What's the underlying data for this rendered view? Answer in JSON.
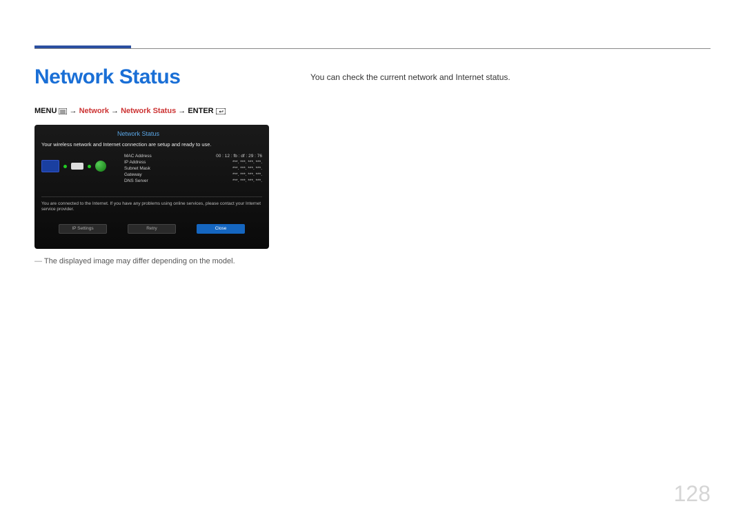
{
  "page": {
    "title": "Network Status",
    "page_number": "128"
  },
  "breadcrumb": {
    "menu_label": "MENU",
    "arrow": "→",
    "item1": "Network",
    "item2": "Network Status",
    "enter_label": "ENTER"
  },
  "screenshot": {
    "title": "Network Status",
    "message": "Your wireless network and Internet connection are setup and ready to use.",
    "rows": [
      {
        "label": "MAC Address",
        "value": "00 : 12 : fb : df : 29 : 76"
      },
      {
        "label": "IP Address",
        "value": "***.   ***.   ***.   ***."
      },
      {
        "label": "Subnet Mask",
        "value": "***.   ***.   ***.   ***."
      },
      {
        "label": "Gateway",
        "value": "***.   ***.   ***.   ***."
      },
      {
        "label": "DNS Server",
        "value": "***.   ***.   ***.   ***."
      }
    ],
    "footer": "You are connected to the Internet. If you have any problems using online services, please contact your Internet service provider.",
    "buttons": {
      "ip_settings": "IP Settings",
      "retry": "Retry",
      "close": "Close"
    }
  },
  "caption": "The displayed image may differ depending on the model.",
  "description": "You can check the current network and Internet status."
}
